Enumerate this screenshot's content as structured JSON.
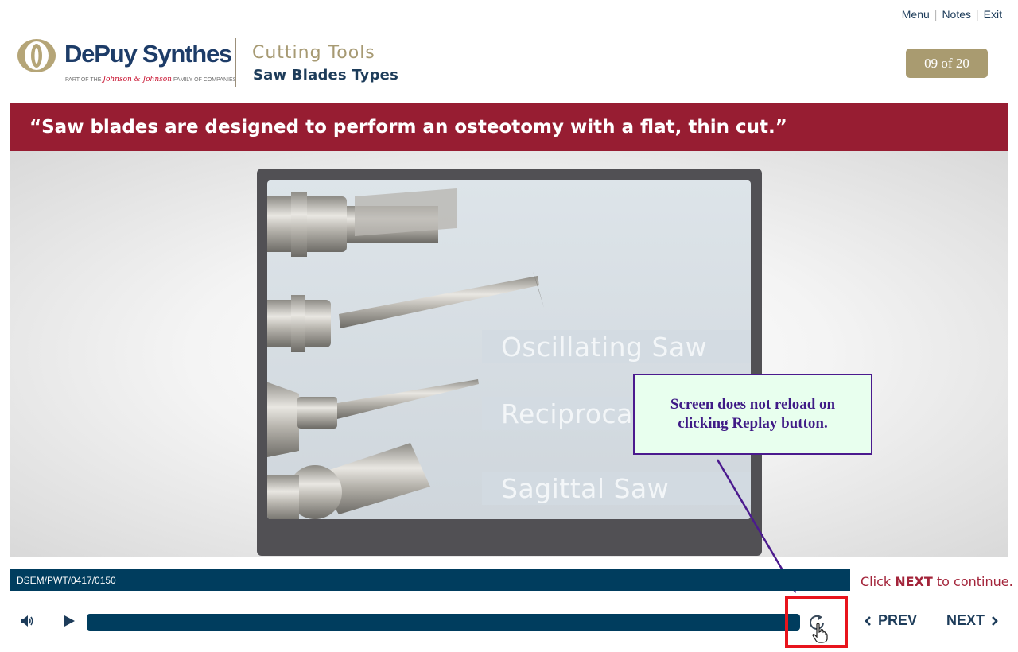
{
  "toplinks": {
    "menu": "Menu",
    "notes": "Notes",
    "exit": "Exit"
  },
  "logo": {
    "brand": "DePuy Synthes",
    "tag_prefix": "PART OF THE",
    "tag_jj": "Johnson & Johnson",
    "tag_suffix": "FAMILY OF COMPANIES"
  },
  "course": {
    "title": "Cutting Tools",
    "subtitle": "Saw Blades Types"
  },
  "counter": "09 of 20",
  "banner": "“Saw blades are designed to perform an osteotomy with a flat, thin cut.”",
  "screen": {
    "labels": [
      "Oscillating Saw",
      "Reciprocat",
      "Sagittal Saw"
    ]
  },
  "callout": "Screen does not reload on clicking Replay button.",
  "status": {
    "code": "DSEM/PWT/0417/0150"
  },
  "hint": {
    "pre": "Click",
    "next": "NEXT",
    "post": "to continue."
  },
  "controls": {
    "prev": "PREV",
    "next": "NEXT"
  },
  "colors": {
    "banner": "#971d32",
    "navy": "#003d5e",
    "gold": "#a99b70",
    "callout_border": "#4b1a8e",
    "highlight": "#e8141d"
  },
  "icons": [
    "volume-icon",
    "play-icon",
    "replay-icon",
    "hand-cursor-icon",
    "chevron-left-icon",
    "chevron-right-icon"
  ]
}
